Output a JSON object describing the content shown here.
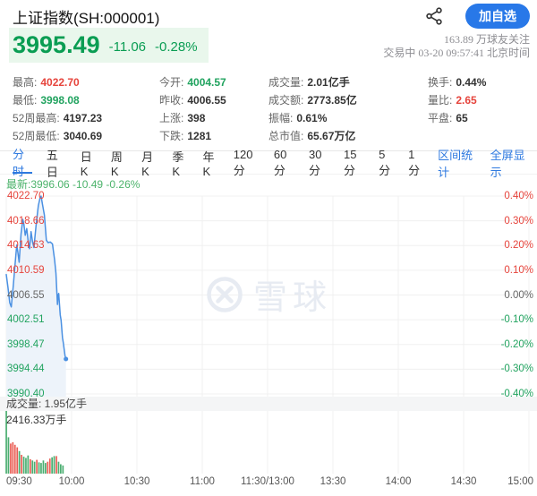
{
  "header": {
    "title": "上证指数(SH:000001)",
    "add_button_label": "加自选",
    "share_icon": "share-icon"
  },
  "quote": {
    "price": "3995.49",
    "change": "-11.06",
    "change_pct": "-0.28%",
    "followers": "163.89 万球友关注",
    "session": "交易中 03-20 09:57:41 北京时间"
  },
  "stats": {
    "col1": [
      {
        "label": "最高:",
        "value": "4022.70"
      },
      {
        "label": "最低:",
        "value": "3998.08"
      },
      {
        "label": "52周最高:",
        "value": "4197.23"
      },
      {
        "label": "52周最低:",
        "value": "3040.69"
      }
    ],
    "col2": [
      {
        "label": "今开:",
        "value": "4004.57"
      },
      {
        "label": "昨收:",
        "value": "4006.55"
      },
      {
        "label": "上涨:",
        "value": "398"
      },
      {
        "label": "下跌:",
        "value": "1281"
      }
    ],
    "col3": [
      {
        "label": "成交量:",
        "value": "2.01亿手"
      },
      {
        "label": "成交额:",
        "value": "2773.85亿"
      },
      {
        "label": "振幅:",
        "value": "0.61%"
      },
      {
        "label": "总市值:",
        "value": "65.67万亿"
      }
    ],
    "col4": [
      {
        "label": "换手:",
        "value": "0.44%"
      },
      {
        "label": "量比:",
        "value": "2.65"
      },
      {
        "label": "平盘:",
        "value": "65"
      }
    ]
  },
  "tabs": {
    "items": [
      "分时",
      "五日",
      "日K",
      "周K",
      "月K",
      "季K",
      "年K",
      "120分",
      "60分",
      "30分",
      "15分",
      "5分",
      "1分"
    ],
    "active_index": 0,
    "right_items": [
      "区间统计",
      "全屏显示"
    ]
  },
  "latest_line": "最新:3996.06 -10.49 -0.26%",
  "watermark": {
    "text": "雪球"
  },
  "colors": {
    "up_red": "#e6443c",
    "down_green": "#21a35f",
    "neutral": "#666666",
    "price_green": "#0a9d53",
    "price_bg": "#e9f7ec",
    "link_blue": "#2f7ae0",
    "button_blue": "#2878e8",
    "line_blue": "#4a90e2",
    "area_fill": "#edf3fa",
    "vol_up": "#ea5f56",
    "vol_down": "#4bae71",
    "latest_green": "#4cb36b",
    "grid": "#f0f0f0",
    "band": "#f4f5f6",
    "watermark": "#e7ebf2"
  },
  "chart_data": {
    "type": "line",
    "title": "上证指数 分时图",
    "price_axis_top": 4022.7,
    "price_axis_bottom": 3990.4,
    "prev_close": 4006.55,
    "latest": 3996.06,
    "left_axis": [
      "4022.70",
      "4018.66",
      "4014.63",
      "4010.59",
      "4006.55",
      "4002.51",
      "3998.47",
      "3994.44",
      "3990.40"
    ],
    "right_axis": [
      "0.40%",
      "0.30%",
      "0.20%",
      "0.10%",
      "0.00%",
      "-0.10%",
      "-0.20%",
      "-0.30%",
      "-0.40%"
    ],
    "x_axis": [
      "09:30",
      "10:00",
      "10:30",
      "11:00",
      "11:30/13:00",
      "13:30",
      "14:00",
      "14:30",
      "15:00"
    ],
    "session_minutes": 240,
    "grid": true,
    "series": [
      {
        "name": "price",
        "points": [
          [
            0,
            4009.9
          ],
          [
            0.8,
            4007.8
          ],
          [
            1.6,
            4005.3
          ],
          [
            2.3,
            4004.6
          ],
          [
            3.2,
            4008.0
          ],
          [
            4.2,
            4012.2
          ],
          [
            4.8,
            4014.7
          ],
          [
            5.3,
            4013.6
          ],
          [
            5.9,
            4011.9
          ],
          [
            6.8,
            4016.5
          ],
          [
            7.6,
            4018.9
          ],
          [
            8.1,
            4018.1
          ],
          [
            8.7,
            4016.3
          ],
          [
            9.4,
            4017.4
          ],
          [
            10.1,
            4015.2
          ],
          [
            10.7,
            4014.1
          ],
          [
            11.4,
            4016.9
          ],
          [
            12.1,
            4015.2
          ],
          [
            12.7,
            4014.3
          ],
          [
            13.7,
            4017.9
          ],
          [
            14.7,
            4021.1
          ],
          [
            15.5,
            4022.4
          ],
          [
            16,
            4022.7
          ],
          [
            16.6,
            4021.4
          ],
          [
            17.5,
            4019.6
          ],
          [
            18.4,
            4015.5
          ],
          [
            19.2,
            4015.1
          ],
          [
            20.2,
            4015.2
          ],
          [
            21.2,
            4014.9
          ],
          [
            22.2,
            4012.3
          ],
          [
            22.8,
            4010.1
          ],
          [
            23.5,
            4005.0
          ],
          [
            23.8,
            4006.5
          ],
          [
            24.1,
            4006.8
          ],
          [
            24.8,
            4003.3
          ],
          [
            25.2,
            4002.4
          ],
          [
            25.8,
            3999.6
          ],
          [
            26.2,
            3998.7
          ],
          [
            26.6,
            3997.7
          ],
          [
            27.0,
            3996.6
          ],
          [
            27.4,
            3996.1
          ]
        ]
      }
    ],
    "volume_label": "成交量: 1.95亿手",
    "volume_max_label": "2416.33万手",
    "volume_bars": [
      {
        "h": 100,
        "c": "g"
      },
      {
        "h": 58,
        "c": "g"
      },
      {
        "h": 48,
        "c": "r"
      },
      {
        "h": 50,
        "c": "r"
      },
      {
        "h": 46,
        "c": "r"
      },
      {
        "h": 42,
        "c": "r"
      },
      {
        "h": 36,
        "c": "g"
      },
      {
        "h": 30,
        "c": "r"
      },
      {
        "h": 27,
        "c": "g"
      },
      {
        "h": 25,
        "c": "g"
      },
      {
        "h": 29,
        "c": "g"
      },
      {
        "h": 23,
        "c": "r"
      },
      {
        "h": 21,
        "c": "g"
      },
      {
        "h": 19,
        "c": "g"
      },
      {
        "h": 22,
        "c": "r"
      },
      {
        "h": 18,
        "c": "g"
      },
      {
        "h": 17,
        "c": "g"
      },
      {
        "h": 21,
        "c": "g"
      },
      {
        "h": 17,
        "c": "g"
      },
      {
        "h": 19,
        "c": "r"
      },
      {
        "h": 24,
        "c": "r"
      },
      {
        "h": 26,
        "c": "g"
      },
      {
        "h": 28,
        "c": "g"
      },
      {
        "h": 28,
        "c": "r"
      },
      {
        "h": 19,
        "c": "g"
      },
      {
        "h": 15,
        "c": "g"
      },
      {
        "h": 13,
        "c": "g"
      }
    ]
  }
}
